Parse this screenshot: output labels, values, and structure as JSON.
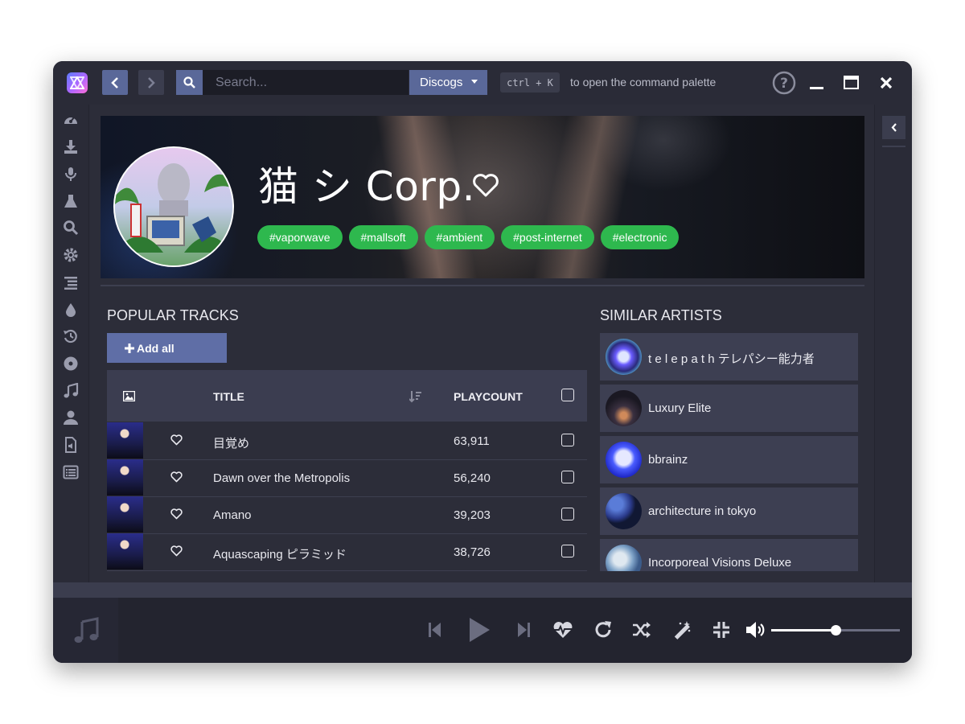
{
  "header": {
    "search_placeholder": "Search...",
    "search_provider": "Discogs",
    "shortcut": "ctrl + K",
    "shortcut_hint": "to open the command palette"
  },
  "sidebar": {
    "items": [
      {
        "icon": "dashboard-icon"
      },
      {
        "icon": "download-icon"
      },
      {
        "icon": "microphone-icon"
      },
      {
        "icon": "flask-icon"
      },
      {
        "icon": "search-icon"
      },
      {
        "icon": "gear-icon"
      },
      {
        "icon": "list-icon"
      },
      {
        "icon": "drop-icon"
      },
      {
        "icon": "history-icon"
      },
      {
        "icon": "disc-icon"
      },
      {
        "icon": "music-note-icon"
      },
      {
        "icon": "user-icon"
      },
      {
        "icon": "audio-file-icon"
      },
      {
        "icon": "list-alt-icon"
      }
    ]
  },
  "artist": {
    "name": "猫 シ Corp.",
    "tags": [
      "#vaporwave",
      "#mallsoft",
      "#ambient",
      "#post-internet",
      "#electronic"
    ]
  },
  "popular_tracks": {
    "heading": "POPULAR TRACKS",
    "add_all_label": "Add all",
    "columns": {
      "title": "TITLE",
      "playcount": "PLAYCOUNT"
    },
    "rows": [
      {
        "title": "目覚め",
        "playcount": "63,911"
      },
      {
        "title": "Dawn over the Metropolis",
        "playcount": "56,240"
      },
      {
        "title": "Amano",
        "playcount": "39,203"
      },
      {
        "title": "Aquascaping ピラミッド",
        "playcount": "38,726"
      }
    ]
  },
  "similar_artists": {
    "heading": "SIMILAR ARTISTS",
    "items": [
      {
        "name": "t e l e p a t h テレパシー能力者"
      },
      {
        "name": "Luxury Elite"
      },
      {
        "name": "bbrainz"
      },
      {
        "name": "architecture in tokyo"
      },
      {
        "name": "Incorporeal Visions Deluxe"
      }
    ]
  },
  "player": {
    "volume": 0.5
  },
  "colors": {
    "accent": "#5a6899",
    "tag_green": "#2eb84e",
    "background": "#23242f"
  }
}
